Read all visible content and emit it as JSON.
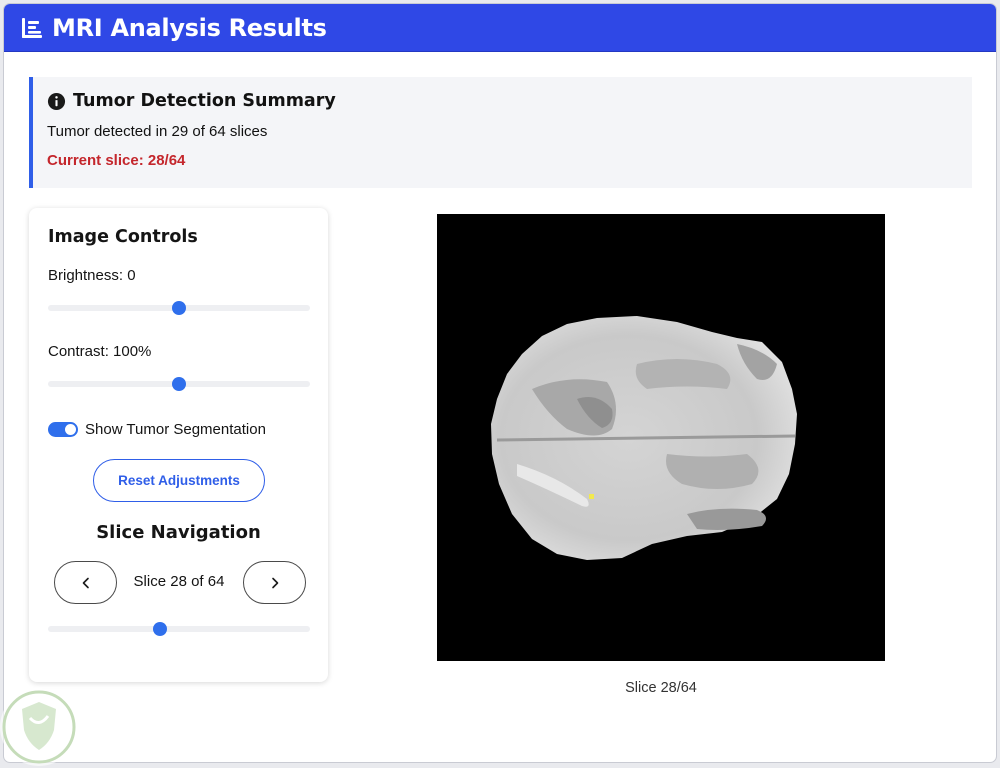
{
  "app": {
    "title": "MRI Analysis Results",
    "icon": "bar-list-icon",
    "header_color": "#2f48e6"
  },
  "summary": {
    "icon": "info-circle-icon",
    "title": "Tumor Detection Summary",
    "detected_text": "Tumor detected in 29 of 64 slices",
    "current_slice_text": "Current slice: 28/64",
    "current_color": "#c4262c",
    "accent_color": "#2f5ee8"
  },
  "controls": {
    "title": "Image Controls",
    "brightness": {
      "label": "Brightness:",
      "value": "0",
      "slider_fraction": 0.5
    },
    "contrast": {
      "label": "Contrast:",
      "value": "100%",
      "slider_fraction": 0.5
    },
    "segmentation_toggle": {
      "label": "Show Tumor Segmentation",
      "on": true
    },
    "reset_label": "Reset Adjustments"
  },
  "navigation": {
    "title": "Slice Navigation",
    "prev_icon": "chevron-left-icon",
    "next_icon": "chevron-right-icon",
    "slice_text": "Slice 28 of 64",
    "current": 28,
    "total": 64
  },
  "viewer": {
    "caption": "Slice 28/64",
    "segmentation_color": "#f2e94e"
  }
}
